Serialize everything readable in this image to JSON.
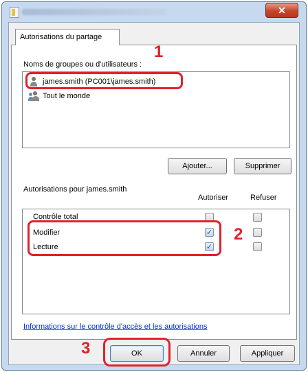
{
  "tab": {
    "label": "Autorisations du partage"
  },
  "groups": {
    "label": "Noms de groupes ou d'utilisateurs :",
    "items": [
      {
        "name": "james.smith (PC001\\james.smith)",
        "icon": "user-icon"
      },
      {
        "name": "Tout le monde",
        "icon": "group-icon"
      }
    ]
  },
  "buttons": {
    "add": "Ajouter...",
    "remove": "Supprimer",
    "ok": "OK",
    "cancel": "Annuler",
    "apply": "Appliquer"
  },
  "permissions": {
    "label": "Autorisations pour james.smith",
    "columns": {
      "allow": "Autoriser",
      "deny": "Refuser"
    },
    "rows": [
      {
        "name": "Contrôle total",
        "allow": false,
        "deny": false
      },
      {
        "name": "Modifier",
        "allow": true,
        "deny": false
      },
      {
        "name": "Lecture",
        "allow": true,
        "deny": false
      }
    ]
  },
  "link": "Informations sur le contrôle d'accès et les autorisations",
  "annotations": {
    "step1": "1",
    "step2": "2",
    "step3": "3"
  },
  "colors": {
    "annotation": "#e0212b",
    "link": "#0033cc",
    "close": "#c6452d"
  }
}
